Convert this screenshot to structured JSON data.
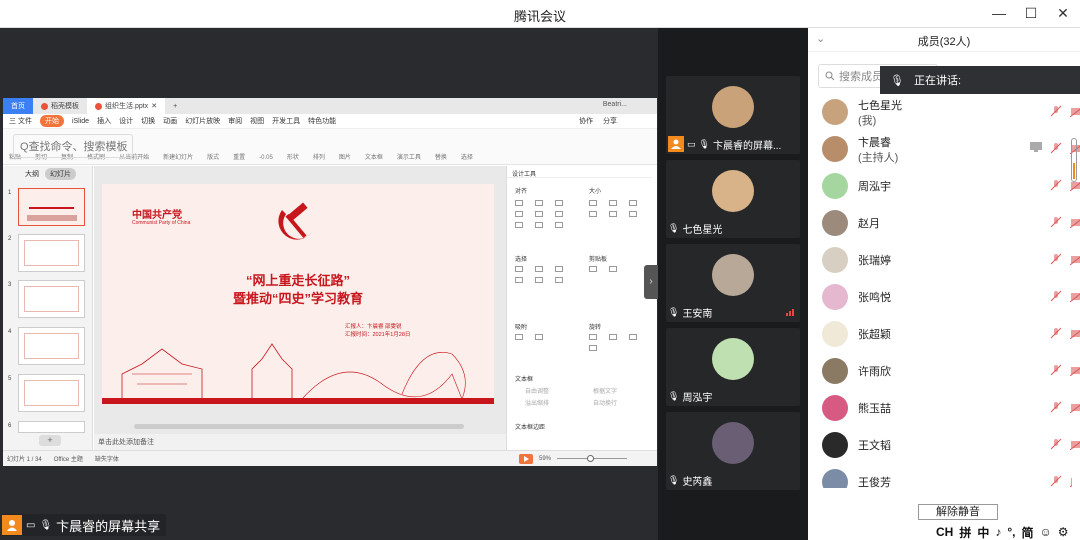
{
  "window": {
    "title": "腾讯会议"
  },
  "wps": {
    "tabs": [
      "首页",
      "稻壳模板",
      "组织生活.pptx"
    ],
    "user": "Beatri...",
    "menu": [
      "三 文件",
      "开始",
      "iSlide",
      "插入",
      "设计",
      "切换",
      "动画",
      "幻灯片放映",
      "审阅",
      "视图",
      "开发工具",
      "特色功能"
    ],
    "menu_search": "Q查找命令、搜索模板",
    "menu_right": [
      "协作",
      "分享"
    ],
    "ribbon": [
      "粘贴",
      "剪切",
      "复制",
      "格式刷",
      "从当前开始",
      "新建幻灯片",
      "版式",
      "重置",
      "-0.05",
      "形状",
      "排列",
      "图片",
      "文本框",
      "演示工具",
      "替换",
      "选择"
    ],
    "panel_tabs": [
      "大纲",
      "幻灯片"
    ],
    "thumbs": [
      "1",
      "2",
      "3",
      "4",
      "5",
      "6"
    ],
    "slide": {
      "party_cn": "中国共产党",
      "party_en": "Communist Party of China",
      "title1": "“网上重走长征路”",
      "title2": "暨推动“四史”学习教育",
      "reporter": "汇报人：卞晨睿    邵雯锐",
      "date": "汇报时间：2021年1月28日"
    },
    "note": "单击此处添加备注",
    "design_panel": {
      "title": "设计工具",
      "sections": [
        "对齐",
        "大小",
        "选择",
        "剪贴板",
        "吸附",
        "旋转",
        "文本框",
        "文本框边距"
      ],
      "options": [
        "自由调整",
        "溢出缩排",
        "根据文字",
        "自动换行"
      ]
    },
    "status": {
      "slide": "幻灯片 1 / 34",
      "theme": "Office 主题",
      "font": "缺失字体",
      "zoom": "59%"
    }
  },
  "share_label": "卞晨睿的屏幕共享",
  "video_tiles": [
    {
      "name": "卞晨睿的屏幕...",
      "avatar_color": "#c9a27a"
    },
    {
      "name": "七色星光",
      "avatar_color": "#d8b38a"
    },
    {
      "name": "王安南",
      "avatar_color": "#b8a898"
    },
    {
      "name": "周泓宇",
      "avatar_color": "#bfe0b0"
    },
    {
      "name": "史芮鑫",
      "avatar_color": "#6a5e74"
    }
  ],
  "members": {
    "header": "成员(32人)",
    "search_placeholder": "搜索成员",
    "speaking": "正在讲话:",
    "list": [
      {
        "name": "七色星光",
        "sub": "(我)",
        "color": "#c6a37c"
      },
      {
        "name": "卞晨睿",
        "sub": "(主持人)",
        "color": "#b78d6a"
      },
      {
        "name": "周泓宇",
        "sub": "",
        "color": "#a6d6a0"
      },
      {
        "name": "赵月",
        "sub": "",
        "color": "#9c8a7c"
      },
      {
        "name": "张瑞婷",
        "sub": "",
        "color": "#d7cfc2"
      },
      {
        "name": "张鸣悦",
        "sub": "",
        "color": "#e5b8d0"
      },
      {
        "name": "张超颖",
        "sub": "",
        "color": "#f1e9d8"
      },
      {
        "name": "许雨欣",
        "sub": "",
        "color": "#8a7a64"
      },
      {
        "name": "熊玉喆",
        "sub": "",
        "color": "#d65a82"
      },
      {
        "name": "王文韬",
        "sub": "",
        "color": "#2a2a2a"
      },
      {
        "name": "王俊芳",
        "sub": "",
        "color": "#7a8ca6"
      }
    ],
    "unmute_all": "解除静音"
  },
  "ime": [
    "CH",
    "拼",
    "中",
    "♪",
    "°,",
    "简",
    "☺",
    "⚙"
  ]
}
